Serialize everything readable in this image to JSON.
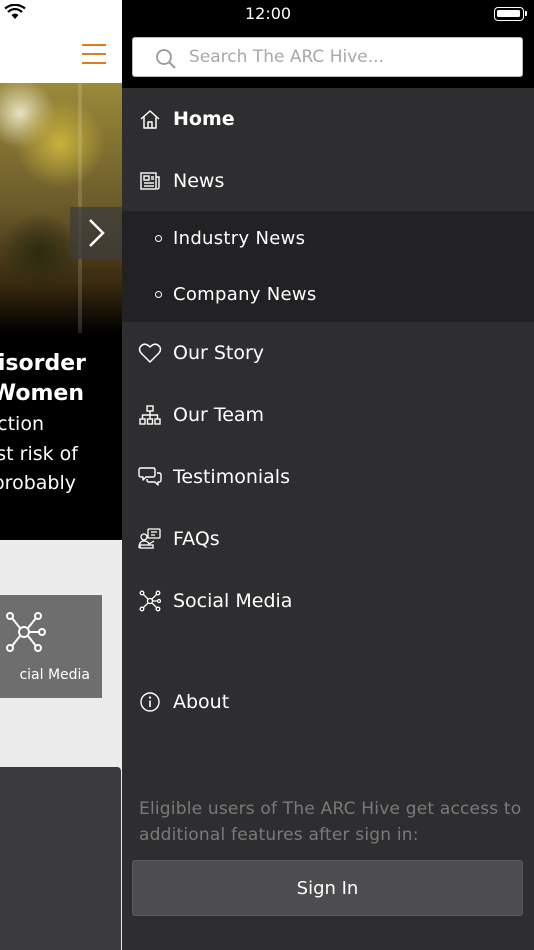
{
  "status_bar": {
    "time": "12:00"
  },
  "background_app": {
    "hero": {
      "line1": "Disorder",
      "line2": "Women",
      "line3": "ction",
      "line4": "est risk of",
      "line5": "probably"
    },
    "tile_label": "cial Media"
  },
  "drawer": {
    "search": {
      "placeholder": "Search The ARC Hive..."
    },
    "nav": {
      "home": "Home",
      "news": "News",
      "industry_news": "Industry News",
      "company_news": "Company News",
      "our_story": "Our Story",
      "our_team": "Our Team",
      "testimonials": "Testimonials",
      "faqs": "FAQs",
      "social_media": "Social Media",
      "about": "About"
    },
    "info_text": "Eligible users of The ARC Hive get access to additional features after sign in:",
    "sign_in_label": "Sign In"
  },
  "colors": {
    "accent": "#e07b22",
    "drawer_bg": "#2e2e30",
    "submenu_bg": "#222224",
    "button_bg": "#4d4d4f"
  },
  "icons": [
    "wifi-icon",
    "battery-icon",
    "hamburger-icon",
    "chevron-right-icon",
    "search-icon",
    "home-icon",
    "newspaper-icon",
    "heart-icon",
    "org-chart-icon",
    "chat-bubbles-icon",
    "faq-icon",
    "network-icon",
    "info-icon"
  ]
}
